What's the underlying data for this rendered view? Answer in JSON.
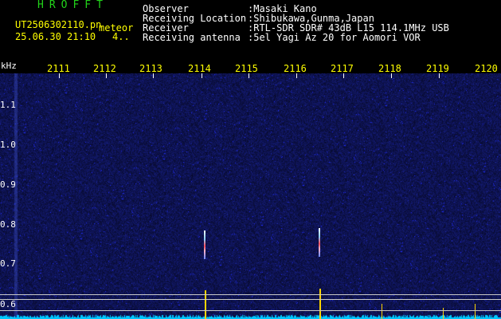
{
  "header": {
    "app_title": "HROFFT",
    "file_name": "UT2506302110.pn",
    "file_suffix": "meteor",
    "date_time": "25.06.30 21:10",
    "counter": "4..",
    "colors": {
      "title": "#22d31a",
      "text": "#ffffff",
      "accent": "#ffff00",
      "tick_label": "#ffff00",
      "y_label": "#ffffff"
    }
  },
  "metadata": [
    {
      "label": "Observer",
      "value": ":Masaki Kano"
    },
    {
      "label": "Receiving Location",
      "value": ":Shibukawa,Gunma,Japan"
    },
    {
      "label": "Receiver",
      "value": ":RTL-SDR SDR# 43dB L15 114.1MHz USB"
    },
    {
      "label": "Receiving antenna",
      "value": ":5el Yagi Az 20 for Aomori VOR"
    }
  ],
  "axis": {
    "y_unit": "kHz",
    "x_ticks": [
      "2111",
      "2112",
      "2113",
      "2114",
      "2115",
      "2116",
      "2117",
      "2118",
      "2119",
      "2120"
    ],
    "y_ticks": [
      "1.1",
      "1.0",
      "0.9",
      "0.8",
      "0.7",
      "0.6"
    ]
  },
  "spectrogram": {
    "background": "#1a1f74",
    "noise": "#3a48c8",
    "baseline": "#00c8ff",
    "trail_color": "#ff4a5a",
    "spike_color": "#ffd400"
  }
}
